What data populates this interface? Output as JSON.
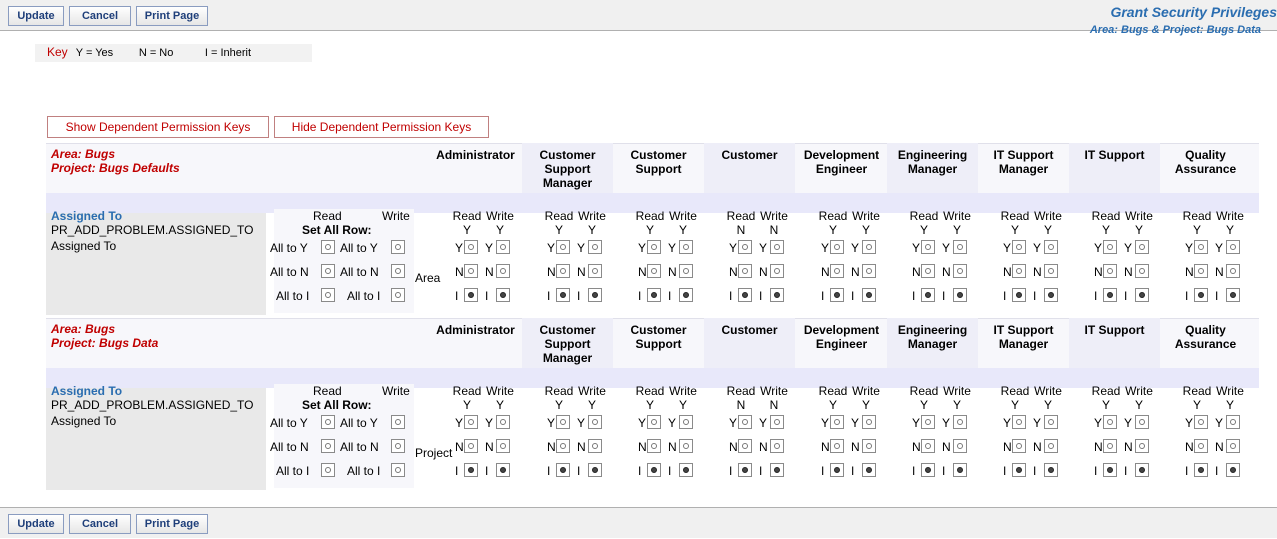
{
  "toolbar": {
    "update": "Update",
    "cancel": "Cancel",
    "print": "Print Page"
  },
  "header": {
    "title": "Grant Security Privileges",
    "subtitle": "Area: Bugs & Project: Bugs Data"
  },
  "key": {
    "label": "Key",
    "yes": "Y = Yes",
    "no": "N = No",
    "inherit": "I = Inherit"
  },
  "dep_buttons": {
    "show": "Show Dependent Permission Keys",
    "hide": "Hide Dependent Permission Keys"
  },
  "roles": [
    {
      "name": "Administrator",
      "read": "Y",
      "write": "Y"
    },
    {
      "name": "Customer Support Manager",
      "read": "Y",
      "write": "Y"
    },
    {
      "name": "Customer Support",
      "read": "Y",
      "write": "Y"
    },
    {
      "name": "Customer",
      "read": "N",
      "write": "N"
    },
    {
      "name": "Development Engineer",
      "read": "Y",
      "write": "Y"
    },
    {
      "name": "Engineering Manager",
      "read": "Y",
      "write": "Y"
    },
    {
      "name": "IT Support Manager",
      "read": "Y",
      "write": "Y"
    },
    {
      "name": "IT Support",
      "read": "Y",
      "write": "Y"
    },
    {
      "name": "Quality Assurance",
      "read": "Y",
      "write": "Y"
    }
  ],
  "common": {
    "read": "Read",
    "write": "Write",
    "set_all_row": "Set All Row:",
    "all_to_y": "All to Y",
    "all_to_n": "All to N",
    "all_to_i": "All to I",
    "opt_y": "Y",
    "opt_n": "N",
    "opt_i": "I",
    "selected": "I"
  },
  "sections": [
    {
      "area": "Area: Bugs",
      "project": "Project: Bugs Defaults",
      "field_title": "Assigned To",
      "field_key": "PR_ADD_PROBLEM.ASSIGNED_TO",
      "field_name": "Assigned To",
      "scope": "Area"
    },
    {
      "area": "Area: Bugs",
      "project": "Project: Bugs Data",
      "field_title": "Assigned To",
      "field_key": "PR_ADD_PROBLEM.ASSIGNED_TO",
      "field_name": "Assigned To",
      "scope": "Project"
    }
  ]
}
